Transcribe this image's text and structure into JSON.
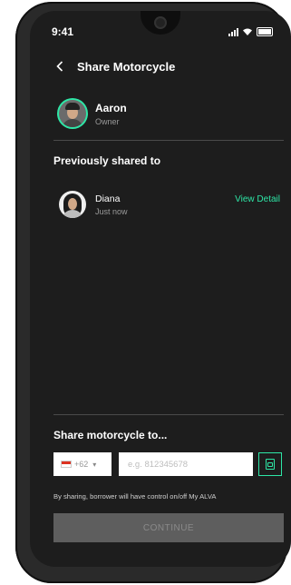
{
  "status_bar": {
    "time": "9:41"
  },
  "header": {
    "title": "Share Motorcycle",
    "back_icon": "chevron-left-icon"
  },
  "owner": {
    "name": "Aaron",
    "role": "Owner"
  },
  "previously_shared": {
    "heading": "Previously shared to",
    "items": [
      {
        "name": "Diana",
        "time": "Just now",
        "action": "View Detail"
      }
    ]
  },
  "share_form": {
    "heading": "Share motorcycle to...",
    "country_code": "+62",
    "phone_placeholder": "e.g. 812345678",
    "contact_icon": "contact-book-icon",
    "note": "By sharing, borrower will have control on/off My ALVA",
    "continue_label": "CONTINUE"
  },
  "colors": {
    "accent": "#2ee6a6",
    "background": "#1d1d1d",
    "button_disabled": "#5e5e5e"
  }
}
